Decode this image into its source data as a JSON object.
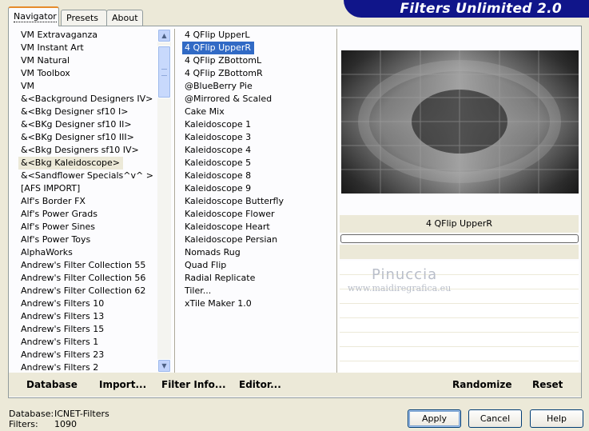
{
  "banner": {
    "title": "Filters Unlimited 2.0"
  },
  "tabs": [
    {
      "label": "Navigator"
    },
    {
      "label": "Presets"
    },
    {
      "label": "About"
    }
  ],
  "categories": {
    "items": [
      "VM Extravaganza",
      "VM Instant Art",
      "VM Natural",
      "VM Toolbox",
      "VM",
      "&<Background Designers IV>",
      "&<Bkg Designer sf10 I>",
      "&<BKg Designer sf10 II>",
      "&<BKg Designer sf10 III>",
      "&<Bkg Designers sf10 IV>",
      "&<Bkg Kaleidoscope>",
      "&<Sandflower Specials^v^ >",
      "[AFS IMPORT]",
      "Alf's Border FX",
      "Alf's Power Grads",
      "Alf's Power Sines",
      "Alf's Power Toys",
      "AlphaWorks",
      "Andrew's Filter Collection 55",
      "Andrew's Filter Collection 56",
      "Andrew's Filter Collection 62",
      "Andrew's Filters 10",
      "Andrew's Filters 13",
      "Andrew's Filters 15",
      "Andrew's Filters 1",
      "Andrew's Filters 23",
      "Andrew's Filters 2"
    ],
    "selected_index": 10
  },
  "filters": {
    "items": [
      "4 QFlip UpperL",
      "4 QFlip UpperR",
      "4 QFlip ZBottomL",
      "4 QFlip ZBottomR",
      "@BlueBerry Pie",
      "@Mirrored & Scaled",
      "Cake Mix",
      "Kaleidoscope 1",
      "Kaleidoscope 3",
      "Kaleidoscope 4",
      "Kaleidoscope 5",
      "Kaleidoscope 8",
      "Kaleidoscope 9",
      "Kaleidoscope Butterfly",
      "Kaleidoscope Flower",
      "Kaleidoscope Heart",
      "Kaleidoscope Persian",
      "Nomads Rug",
      "Quad Flip",
      "Radial Replicate",
      "Tiler...",
      "xTile Maker 1.0"
    ],
    "selected_index": 1
  },
  "preview": {
    "filter_name": "4 QFlip UpperR",
    "progress": 0
  },
  "watermark": {
    "name": "Pinuccia",
    "url": "www.maidiregrafica.eu"
  },
  "toolbar": {
    "database": "Database",
    "import": "Import...",
    "filter_info": "Filter Info...",
    "editor": "Editor...",
    "randomize": "Randomize",
    "reset": "Reset"
  },
  "status": {
    "database_label": "Database:",
    "database_value": "ICNET-Filters",
    "filters_label": "Filters:",
    "filters_value": "1090"
  },
  "buttons": {
    "apply": "Apply",
    "cancel": "Cancel",
    "help": "Help"
  },
  "colors": {
    "selection": "#316ac5",
    "banner": "#10158a",
    "face": "#ece9d8"
  }
}
